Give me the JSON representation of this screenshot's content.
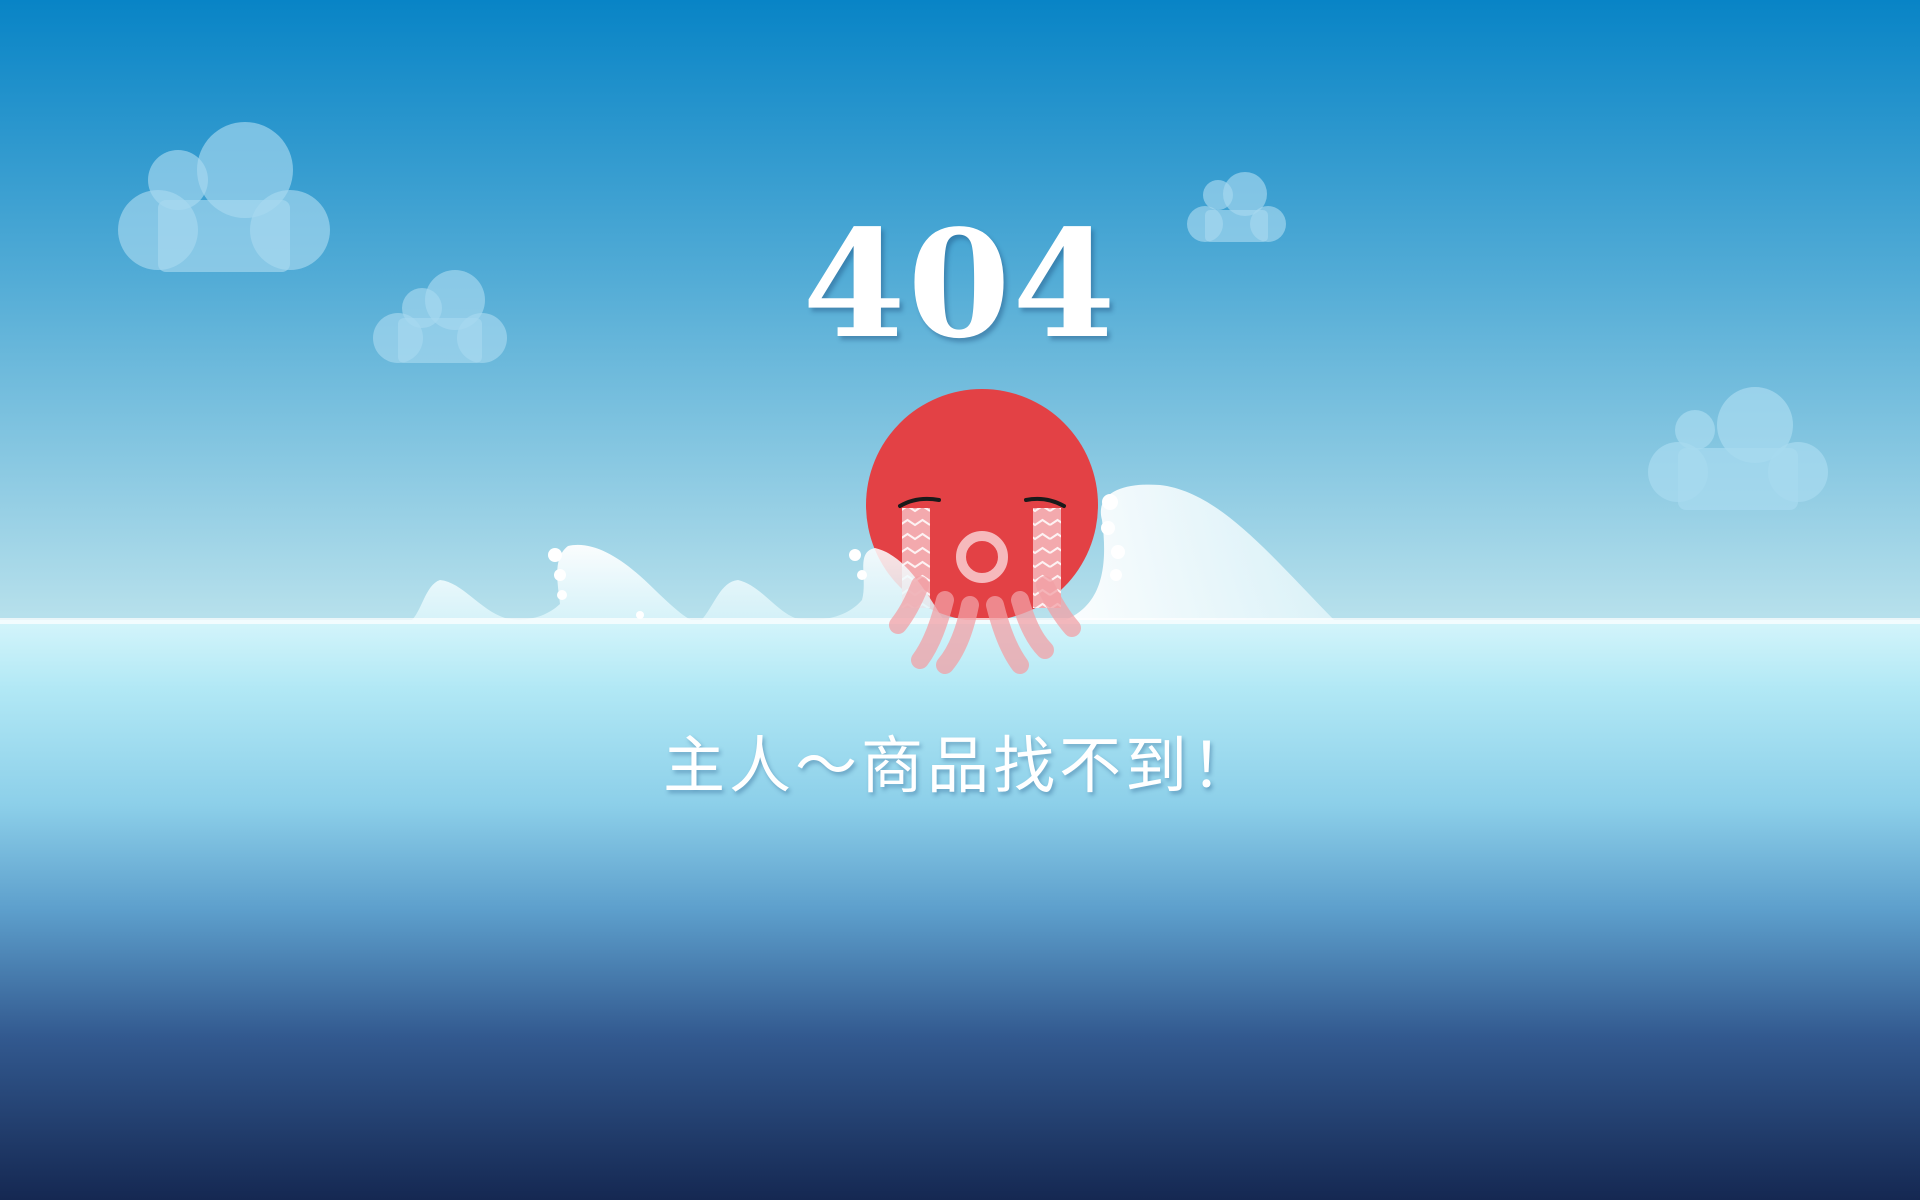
{
  "page": {
    "error_code": "404",
    "message": "主人～商品找不到！"
  },
  "colors": {
    "sky_top": "#0a86c8",
    "sky_bottom": "#b8e2ee",
    "sea_top": "#c6f2fa",
    "sea_bottom": "#172a55",
    "octopus": "#e34145",
    "cloud": "#a7d9ef"
  },
  "icons": {
    "mascot": "crying-octopus-icon"
  }
}
